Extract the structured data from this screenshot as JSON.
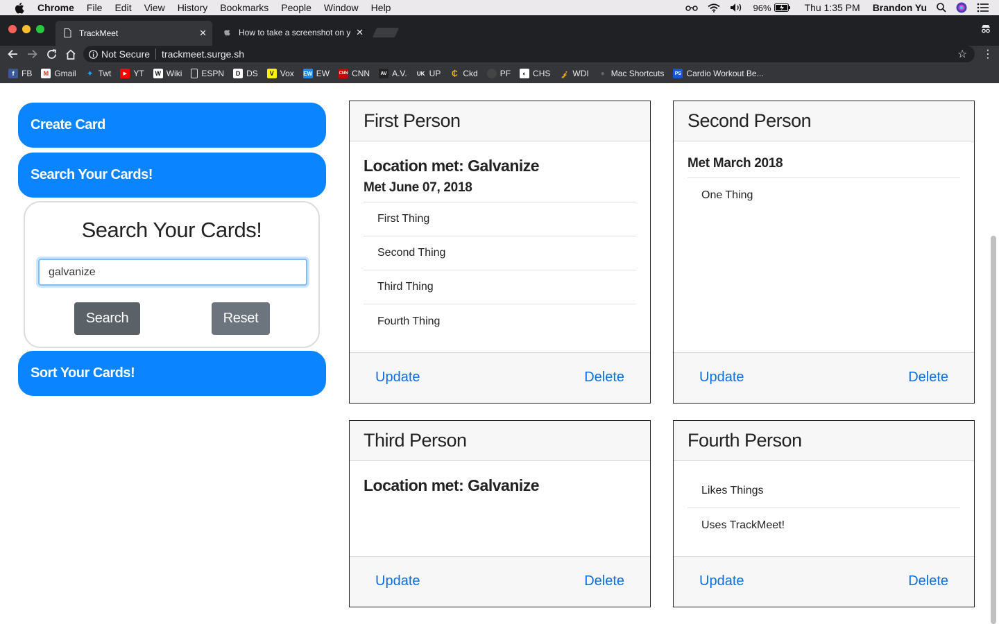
{
  "menubar": {
    "app": "Chrome",
    "items": [
      "File",
      "Edit",
      "View",
      "History",
      "Bookmarks",
      "People",
      "Window",
      "Help"
    ],
    "battery": "96%",
    "clock": "Thu 1:35 PM",
    "user": "Brandon Yu"
  },
  "browser": {
    "tabs": [
      {
        "title": "TrackMeet"
      },
      {
        "title": "How to take a screenshot on y"
      }
    ],
    "security": "Not Secure",
    "url": "trackmeet.surge.sh",
    "bookmarks": [
      "FB",
      "Gmail",
      "Twt",
      "YT",
      "Wiki",
      "ESPN",
      "DS",
      "Vox",
      "EW",
      "CNN",
      "A.V.",
      "UP",
      "Ckd",
      "PF",
      "CHS",
      "WDI",
      "Mac Shortcuts",
      "Cardio Workout Be..."
    ]
  },
  "sidebar": {
    "create_label": "Create Card",
    "search_label": "Search Your Cards!",
    "sort_label": "Sort Your Cards!",
    "search_panel": {
      "title": "Search Your Cards!",
      "query": "galvanize",
      "search_button": "Search",
      "reset_button": "Reset"
    }
  },
  "cards": [
    {
      "name": "First Person",
      "location": "Location met: Galvanize",
      "met": "Met June 07, 2018",
      "things": [
        "First Thing",
        "Second Thing",
        "Third Thing",
        "Fourth Thing"
      ],
      "update": "Update",
      "delete": "Delete"
    },
    {
      "name": "Second Person",
      "met": "Met March 2018",
      "things": [
        "One Thing"
      ],
      "update": "Update",
      "delete": "Delete"
    },
    {
      "name": "Third Person",
      "location": "Location met: Galvanize",
      "update": "Update",
      "delete": "Delete"
    },
    {
      "name": "Fourth Person",
      "things": [
        "Likes Things",
        "Uses TrackMeet!"
      ],
      "update": "Update",
      "delete": "Delete"
    }
  ]
}
